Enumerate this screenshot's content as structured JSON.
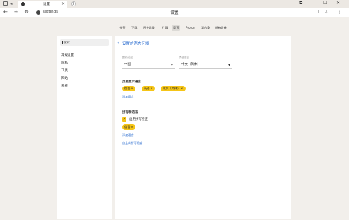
{
  "tab": {
    "title": "设置",
    "close": "×",
    "new_tab": "+"
  },
  "window_controls": [
    "⧉",
    "—",
    "☐",
    "✕"
  ],
  "toolbar": {
    "back": "←",
    "forward": "→",
    "reload": "↻",
    "address": "settings",
    "title": "设置"
  },
  "topnav": [
    "书签",
    "下载",
    "历史记录",
    "扩展",
    "设置",
    "Proton",
    "我的ID",
    "所有设备"
  ],
  "sidebar": {
    "search_placeholder": "搜索",
    "items": [
      "常规设置",
      "隐私",
      "工具",
      "网站",
      "系统"
    ]
  },
  "content": {
    "title": "设置的语言区域",
    "region": {
      "label": "国家/地区",
      "value": "中国"
    },
    "ui_language": {
      "label": "界面语言",
      "value": "中文（简体）"
    },
    "display_langs": {
      "title": "页面显示语言",
      "chips": [
        "俄语",
        "英语",
        "中文（简体）"
      ],
      "add_link": "添加语言"
    },
    "spelling": {
      "title": "拼写和语法",
      "checkbox_label": "启用拼写检查",
      "checked": true,
      "chips": [
        "俄语"
      ],
      "add_link": "添加语言",
      "custom_link": "自定义拼写检查"
    }
  },
  "colors": {
    "accent": "#f5c518",
    "link": "#2a6ccf",
    "bg": "#f2efeb"
  }
}
